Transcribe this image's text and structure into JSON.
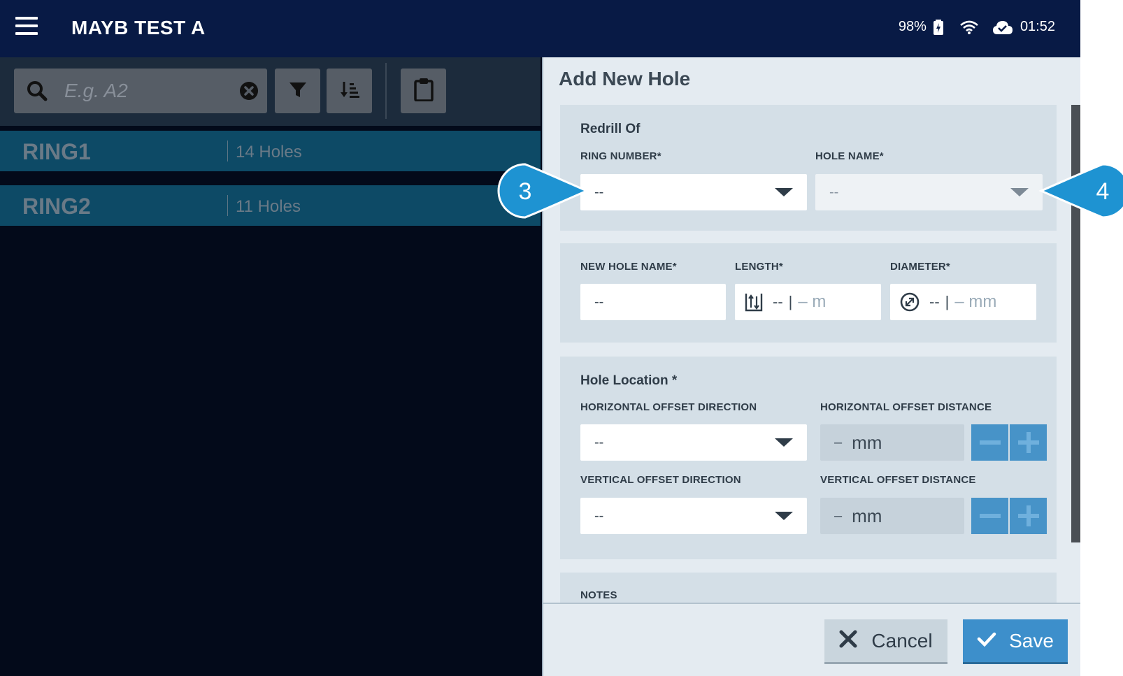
{
  "header": {
    "title": "MAYB TEST A",
    "battery": "98%",
    "time": "01:52"
  },
  "left_panel": {
    "search": {
      "placeholder": "E.g. A2",
      "value": ""
    },
    "rings": [
      {
        "name": "RING1",
        "count": "14 Holes"
      },
      {
        "name": "RING2",
        "count": "11 Holes"
      }
    ]
  },
  "form": {
    "title": "Add New Hole",
    "redrill": {
      "title": "Redrill Of",
      "ring_number_label": "RING NUMBER*",
      "ring_number_value": "--",
      "hole_name_label": "HOLE NAME*",
      "hole_name_value": "--"
    },
    "hole_details": {
      "new_hole_name_label": "NEW HOLE NAME*",
      "new_hole_name_value": "--",
      "length_label": "LENGTH*",
      "length_value": "--",
      "length_sep": "|",
      "length_unit": "– m",
      "diameter_label": "DIAMETER*",
      "diameter_value": "--",
      "diameter_sep": "|",
      "diameter_unit": "– mm"
    },
    "location": {
      "title": "Hole Location *",
      "h_dir_label": "HORIZONTAL OFFSET DIRECTION",
      "h_dir_value": "--",
      "h_dist_label": "HORIZONTAL OFFSET DISTANCE",
      "h_dist_value": "–",
      "h_dist_unit": "mm",
      "v_dir_label": "VERTICAL OFFSET DIRECTION",
      "v_dir_value": "--",
      "v_dist_label": "VERTICAL OFFSET DISTANCE",
      "v_dist_value": "–",
      "v_dist_unit": "mm"
    },
    "notes": {
      "label": "NOTES"
    },
    "cancel_label": "Cancel",
    "save_label": "Save"
  },
  "callouts": {
    "left": "3",
    "right": "4"
  },
  "colors": {
    "topbar": "#081a45",
    "ring_row": "#0d4a66",
    "accent_blue": "#3d8fcb",
    "callout": "#1e93d2"
  }
}
